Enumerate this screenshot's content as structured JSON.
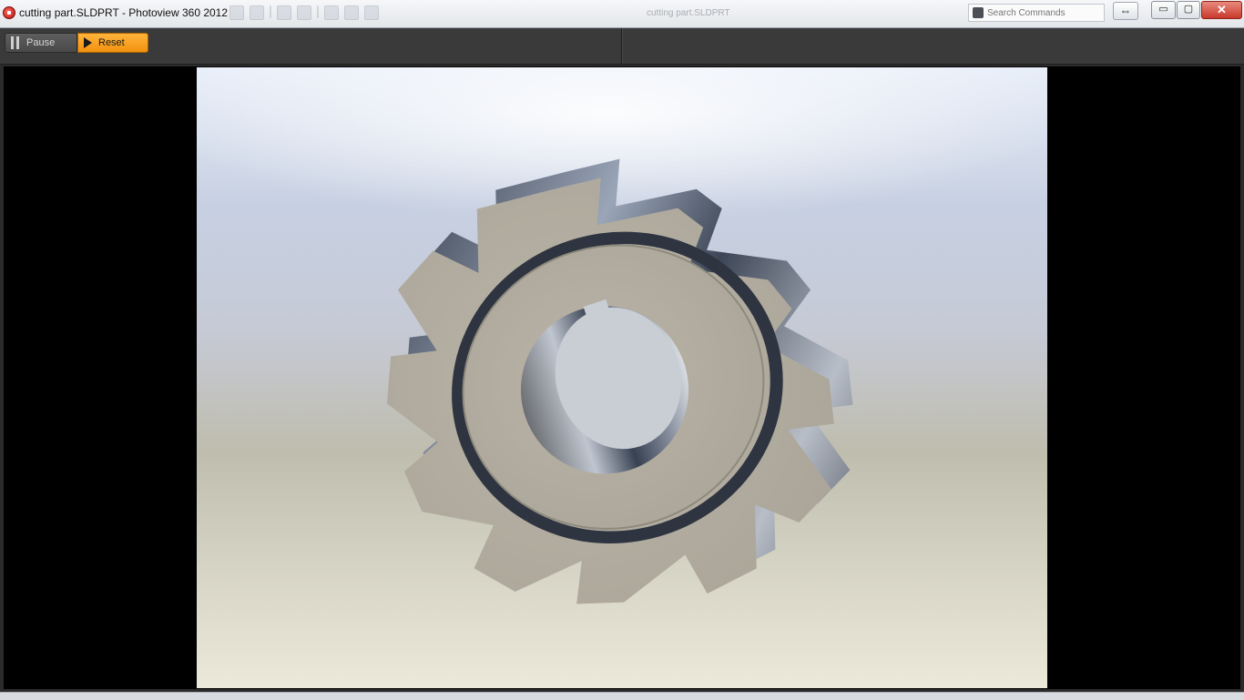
{
  "window": {
    "title": "cutting part.SLDPRT - Photoview 360 2012",
    "doc_title": "cutting part.SLDPRT",
    "search_placeholder": "Search Commands",
    "controls": {
      "minimize": "▭",
      "maximize": "▢",
      "close": "✕",
      "swap": "⇔"
    }
  },
  "toolbar": {
    "pause_label": "Pause",
    "reset_label": "Reset",
    "accent_color": "#f7a020"
  },
  "icons": {
    "app": "photoview-app-icon",
    "pause": "pause-icon",
    "play": "play-icon",
    "search": "search-icon"
  }
}
